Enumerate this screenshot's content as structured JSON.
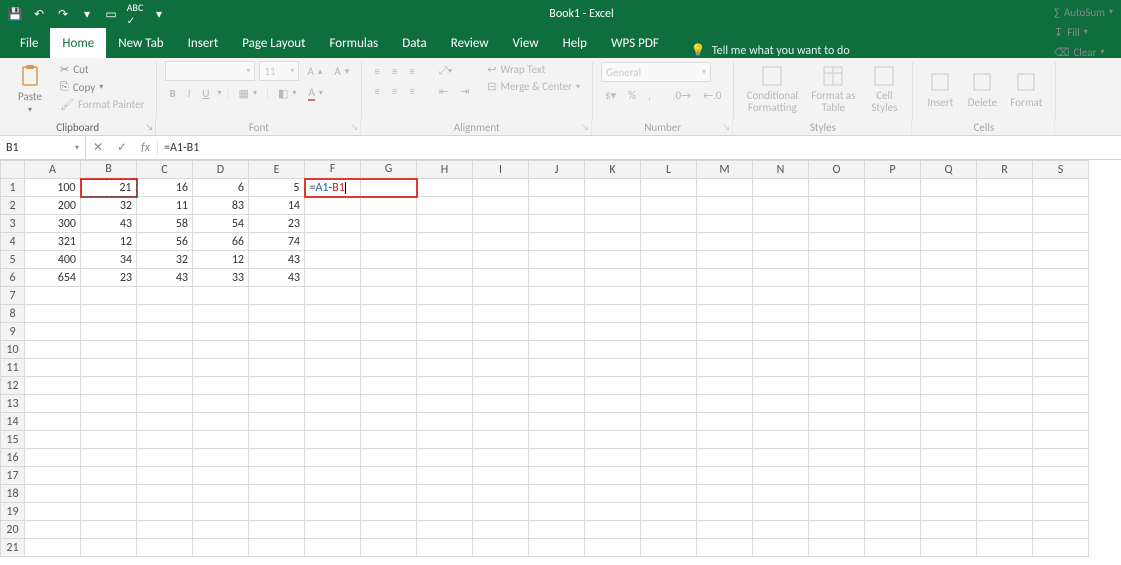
{
  "title": "Book1 - Excel",
  "tabs": [
    "File",
    "Home",
    "New Tab",
    "Insert",
    "Page Layout",
    "Formulas",
    "Data",
    "Review",
    "View",
    "Help",
    "WPS PDF"
  ],
  "active_tab": "Home",
  "tellme_placeholder": "Tell me what you want to do",
  "ribbon": {
    "clipboard": {
      "paste": "Paste",
      "cut": "Cut",
      "copy": "Copy",
      "format_painter": "Format Painter",
      "label": "Clipboard"
    },
    "font": {
      "name_placeholder": "",
      "size": "11",
      "label": "Font",
      "bold": "B",
      "italic": "I",
      "underline": "U"
    },
    "alignment": {
      "wrap": "Wrap Text",
      "merge": "Merge & Center",
      "label": "Alignment"
    },
    "number": {
      "format": "General",
      "label": "Number"
    },
    "styles": {
      "cond": "Conditional Formatting",
      "table": "Format as Table",
      "cell": "Cell Styles",
      "label": "Styles"
    },
    "cells": {
      "insert": "Insert",
      "delete": "Delete",
      "format": "Format",
      "label": "Cells"
    },
    "editing": {
      "autosum": "AutoSum",
      "fill": "Fill",
      "clear": "Clear"
    }
  },
  "namebox": "B1",
  "formula": "=A1-B1",
  "columns": [
    "A",
    "B",
    "C",
    "D",
    "E",
    "F",
    "G",
    "H",
    "I",
    "J",
    "K",
    "L",
    "M",
    "N",
    "O",
    "P",
    "Q",
    "R",
    "S"
  ],
  "row_count": 21,
  "cell_data": [
    [
      "100",
      "21",
      "16",
      "6",
      "5",
      "=A1-B1"
    ],
    [
      "200",
      "32",
      "11",
      "83",
      "14",
      ""
    ],
    [
      "300",
      "43",
      "58",
      "54",
      "23",
      ""
    ],
    [
      "321",
      "12",
      "56",
      "66",
      "74",
      ""
    ],
    [
      "400",
      "34",
      "32",
      "12",
      "43",
      ""
    ],
    [
      "654",
      "23",
      "43",
      "33",
      "43",
      ""
    ]
  ],
  "editing_cell": {
    "row": 1,
    "col": "F",
    "refA": "A1",
    "refB": "B1"
  },
  "highlight_b1": true,
  "highlight_f1": true
}
